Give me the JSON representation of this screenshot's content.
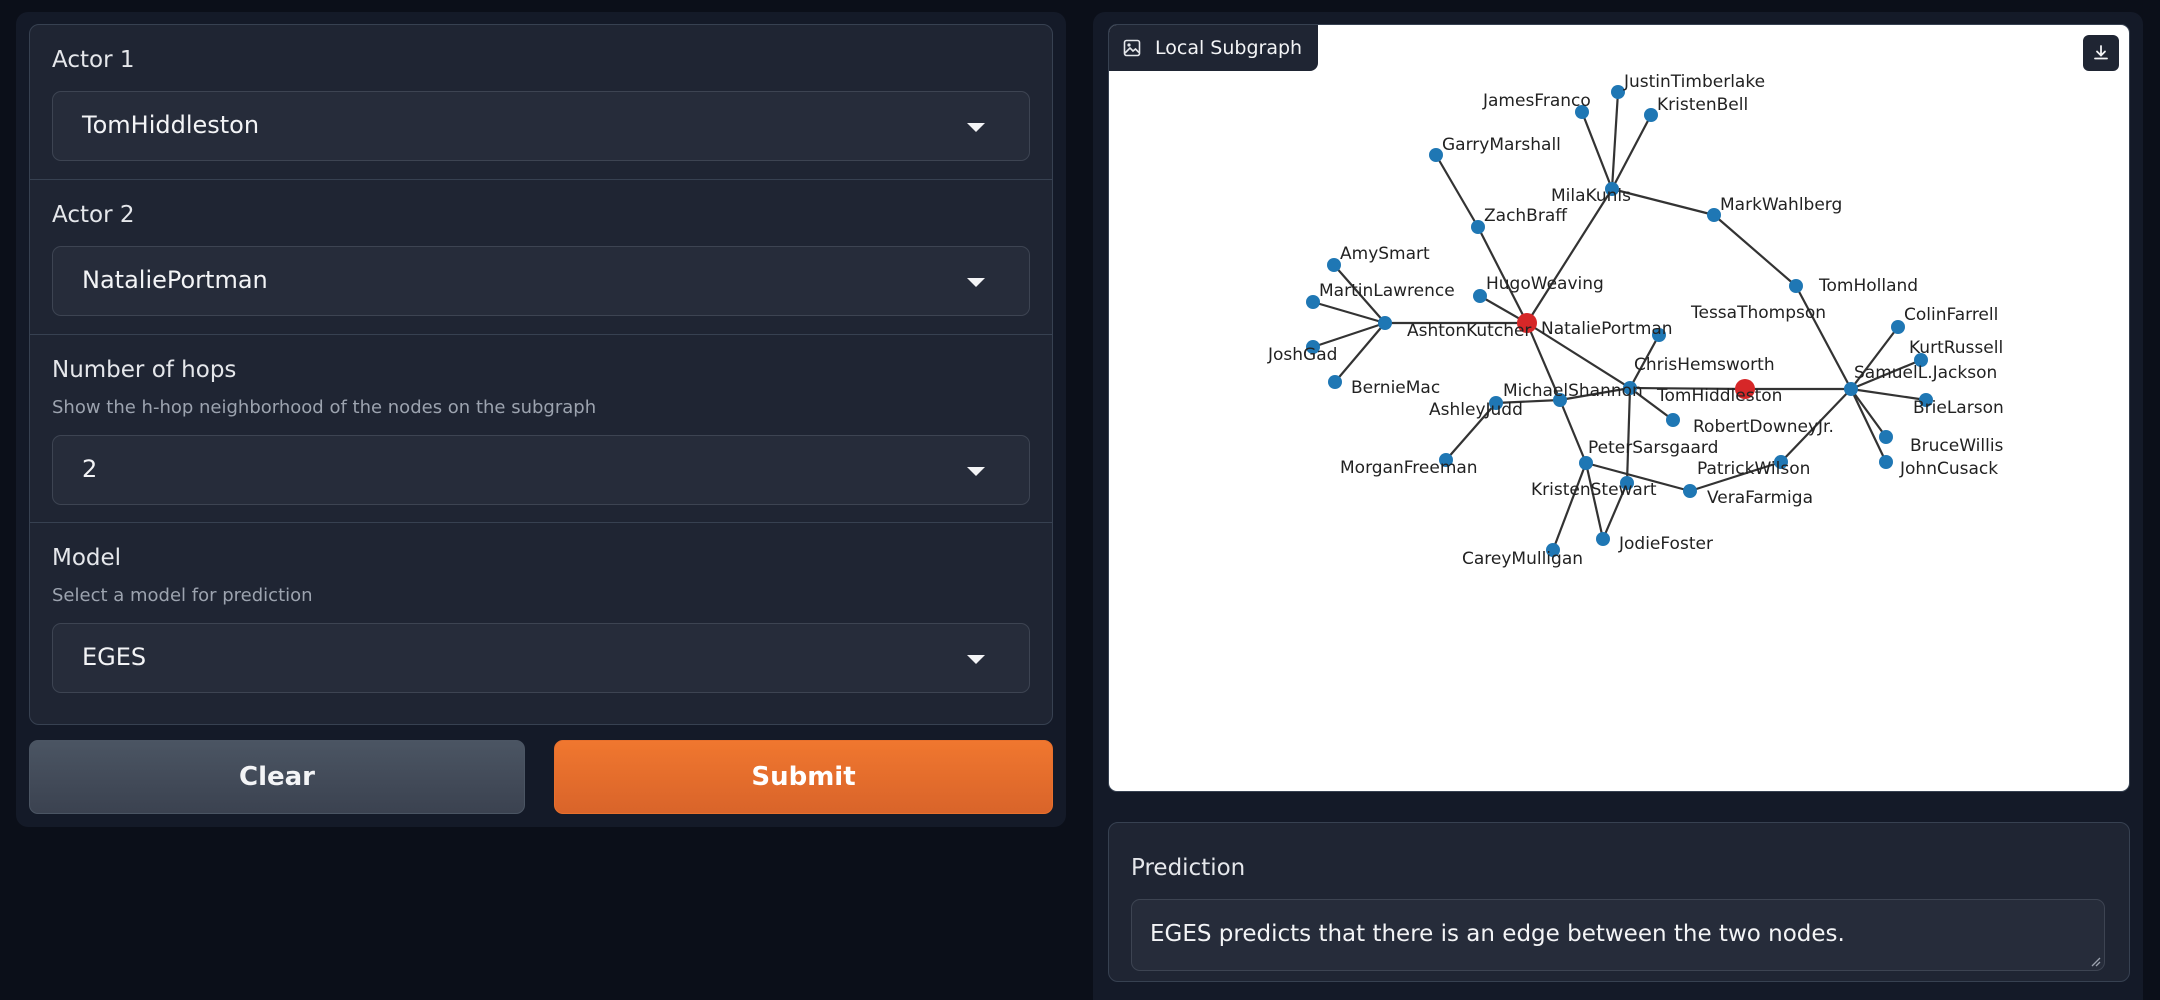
{
  "form": {
    "actor1": {
      "label": "Actor 1",
      "value": "TomHiddleston"
    },
    "actor2": {
      "label": "Actor 2",
      "value": "NataliePortman"
    },
    "hops": {
      "label": "Number of hops",
      "info": "Show the h-hop neighborhood of the nodes on the subgraph",
      "value": "2"
    },
    "model": {
      "label": "Model",
      "info": "Select a model for prediction",
      "value": "EGES"
    }
  },
  "buttons": {
    "clear": "Clear",
    "submit": "Submit"
  },
  "graph": {
    "title": "Local Subgraph",
    "highlight_color": "#d62728",
    "node_color": "#1f77b4",
    "nodes": [
      {
        "name": "JustinTimberlake"
      },
      {
        "name": "JamesFranco"
      },
      {
        "name": "KristenBell"
      },
      {
        "name": "GarryMarshall"
      },
      {
        "name": "MilaKunis"
      },
      {
        "name": "MarkWahlberg"
      },
      {
        "name": "ZachBraff"
      },
      {
        "name": "AmySmart"
      },
      {
        "name": "HugoWeaving"
      },
      {
        "name": "MartinLawrence"
      },
      {
        "name": "TomHolland"
      },
      {
        "name": "TessaThompson"
      },
      {
        "name": "ColinFarrell"
      },
      {
        "name": "AshtonKutcher"
      },
      {
        "name": "NataliePortman",
        "highlight": true
      },
      {
        "name": "JoshGad"
      },
      {
        "name": "KurtRussell"
      },
      {
        "name": "ChrisHemsworth"
      },
      {
        "name": "SamuelL.Jackson"
      },
      {
        "name": "BernieMac"
      },
      {
        "name": "MichaelShannon"
      },
      {
        "name": "TomHiddleston",
        "highlight": true
      },
      {
        "name": "AshleyJudd"
      },
      {
        "name": "BrieLarson"
      },
      {
        "name": "RobertDowneyJr."
      },
      {
        "name": "BruceWillis"
      },
      {
        "name": "PeterSarsgaard"
      },
      {
        "name": "MorganFreeman"
      },
      {
        "name": "PatrickWilson"
      },
      {
        "name": "JohnCusack"
      },
      {
        "name": "KristenStewart"
      },
      {
        "name": "VeraFarmiga"
      },
      {
        "name": "JodieFoster"
      },
      {
        "name": "CareyMulligan"
      }
    ],
    "edges": [
      [
        "JustinTimberlake",
        "MilaKunis"
      ],
      [
        "JamesFranco",
        "MilaKunis"
      ],
      [
        "KristenBell",
        "MilaKunis"
      ],
      [
        "MilaKunis",
        "MarkWahlberg"
      ],
      [
        "MilaKunis",
        "NataliePortman"
      ],
      [
        "MarkWahlberg",
        "TomHolland"
      ],
      [
        "TomHolland",
        "SamuelL.Jackson"
      ],
      [
        "GarryMarshall",
        "ZachBraff"
      ],
      [
        "ZachBraff",
        "NataliePortman"
      ],
      [
        "HugoWeaving",
        "NataliePortman"
      ],
      [
        "AshtonKutcher",
        "NataliePortman"
      ],
      [
        "AmySmart",
        "AshtonKutcher"
      ],
      [
        "MartinLawrence",
        "AshtonKutcher"
      ],
      [
        "JoshGad",
        "AshtonKutcher"
      ],
      [
        "BernieMac",
        "AshtonKutcher"
      ],
      [
        "NataliePortman",
        "MichaelShannon"
      ],
      [
        "NataliePortman",
        "ChrisHemsworth"
      ],
      [
        "TessaThompson",
        "ChrisHemsworth"
      ],
      [
        "MichaelShannon",
        "ChrisHemsworth"
      ],
      [
        "MichaelShannon",
        "AshleyJudd"
      ],
      [
        "MichaelShannon",
        "PeterSarsgaard"
      ],
      [
        "AshleyJudd",
        "MorganFreeman"
      ],
      [
        "ChrisHemsworth",
        "TomHiddleston"
      ],
      [
        "ChrisHemsworth",
        "RobertDowneyJr."
      ],
      [
        "ChrisHemsworth",
        "KristenStewart"
      ],
      [
        "TomHiddleston",
        "SamuelL.Jackson"
      ],
      [
        "SamuelL.Jackson",
        "ColinFarrell"
      ],
      [
        "SamuelL.Jackson",
        "KurtRussell"
      ],
      [
        "SamuelL.Jackson",
        "BrieLarson"
      ],
      [
        "SamuelL.Jackson",
        "BruceWillis"
      ],
      [
        "SamuelL.Jackson",
        "JohnCusack"
      ],
      [
        "SamuelL.Jackson",
        "PatrickWilson"
      ],
      [
        "PatrickWilson",
        "VeraFarmiga"
      ],
      [
        "PeterSarsgaard",
        "VeraFarmiga"
      ],
      [
        "PeterSarsgaard",
        "CareyMulligan"
      ],
      [
        "PeterSarsgaard",
        "JodieFoster"
      ],
      [
        "KristenStewart",
        "JodieFoster"
      ]
    ]
  },
  "prediction": {
    "label": "Prediction",
    "text": "EGES predicts that there is an edge between the two nodes."
  }
}
